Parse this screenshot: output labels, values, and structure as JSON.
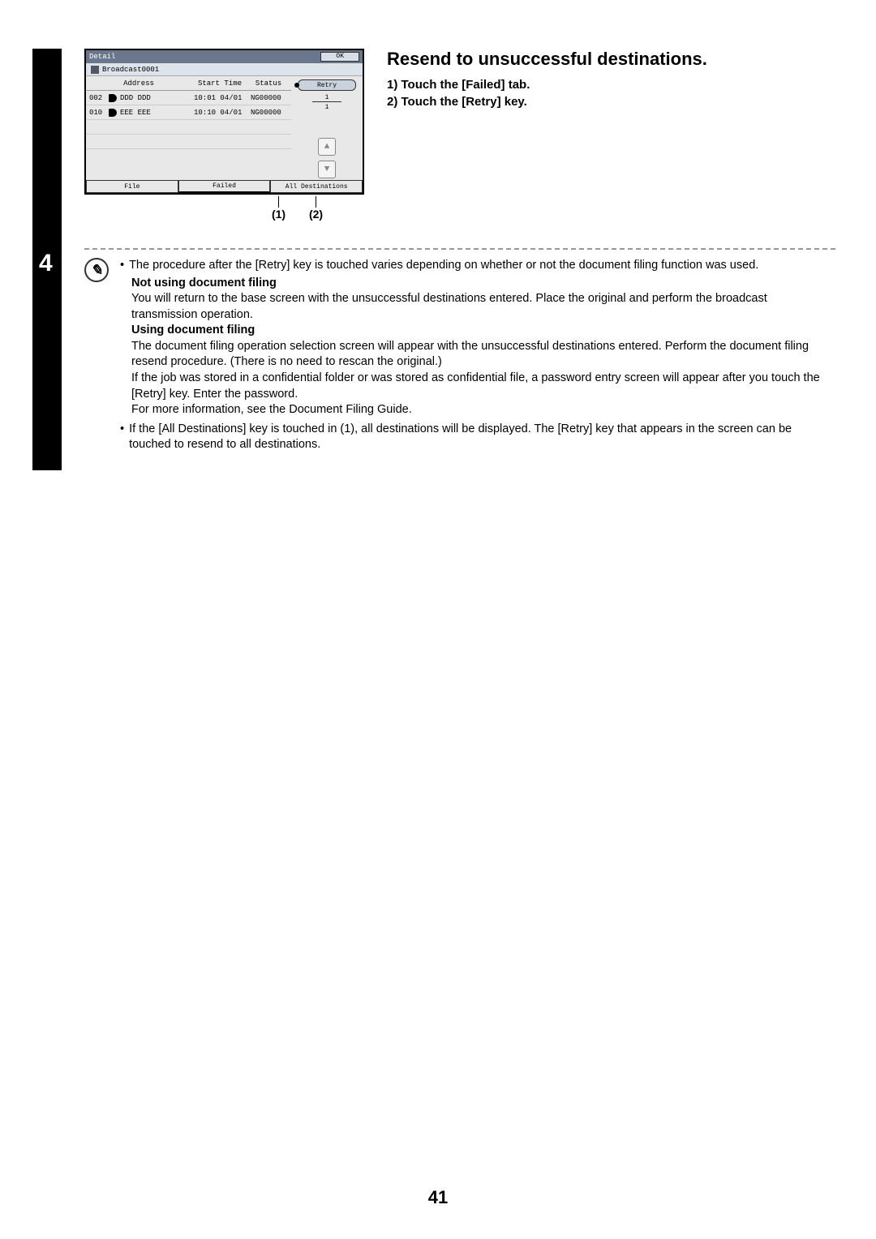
{
  "step_number": "4",
  "screenshot": {
    "title": "Detail",
    "ok_label": "OK",
    "broadcast_label": "Broadcast0001",
    "headers": {
      "address": "Address",
      "start_time": "Start Time",
      "status": "Status"
    },
    "rows": [
      {
        "num": "002",
        "addr": "DDD DDD",
        "time": "10:01 04/01",
        "status": "NG00000"
      },
      {
        "num": "010",
        "addr": "EEE EEE",
        "time": "10:10 04/01",
        "status": "NG00000"
      }
    ],
    "retry_label": "Retry",
    "page_top": "1",
    "page_bottom": "1",
    "tabs": {
      "file": "File",
      "failed": "Failed",
      "all": "All Destinations"
    }
  },
  "callout_1": "(1)",
  "callout_2": "(2)",
  "instructions": {
    "title": "Resend to unsuccessful destinations.",
    "step1": "1)  Touch the [Failed] tab.",
    "step2": "2)  Touch the [Retry] key."
  },
  "notes": {
    "bullet1": "The procedure after the [Retry] key is touched varies depending on whether or not the document filing function was used.",
    "h1": "Not using document filing",
    "p1": "You will return to the base screen with the unsuccessful destinations entered. Place the original and perform the broadcast transmission operation.",
    "h2": "Using document filing",
    "p2": "The document filing operation selection screen will appear with the unsuccessful destinations entered. Perform the document filing resend procedure. (There is no need to rescan the original.)",
    "p3": "If the job was stored in a confidential folder or was stored as confidential file, a password entry screen will appear after you touch the [Retry] key. Enter the password.",
    "p4": "For more information, see the Document Filing Guide.",
    "bullet2": "If the [All Destinations] key is touched in (1), all destinations will be displayed. The [Retry] key that appears in the screen can be touched to resend to all destinations."
  },
  "page_number": "41"
}
